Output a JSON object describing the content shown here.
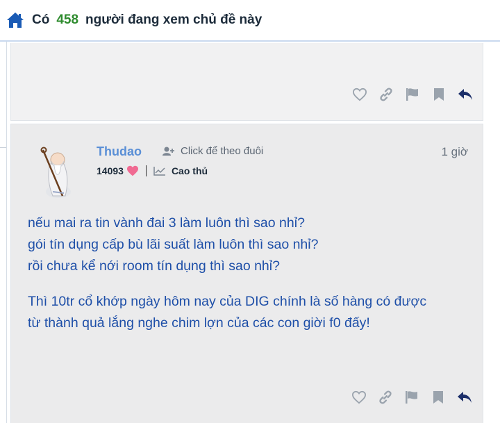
{
  "header": {
    "prefix": "Có",
    "viewer_count": "458",
    "suffix": "người đang xem chủ đề này",
    "home_icon": "home-icon",
    "accent_color": "#1a5bb5",
    "count_color": "#2e8b2e"
  },
  "actions": {
    "icons": [
      "heart-outline-icon",
      "link-icon",
      "flag-icon",
      "bookmark-icon",
      "reply-icon"
    ]
  },
  "post": {
    "username": "Thudao",
    "follow_label": "Click để theo đuôi",
    "time": "1 giờ",
    "points": "14093",
    "rank": "Cao thủ",
    "lines": [
      "nếu mai ra tin vành đai 3 làm luôn thì sao nhỉ?",
      "gói tín dụng cấp bù lãi suất làm luôn thì sao nhỉ?",
      "rồi chưa kể nới room tín dụng thì sao nhỉ?",
      "Thì 10tr cổ khớp ngày hôm nay của DIG chính là số hàng có được",
      "từ thành quả lắng nghe chim lợn của các con giời f0 đấy!"
    ]
  }
}
